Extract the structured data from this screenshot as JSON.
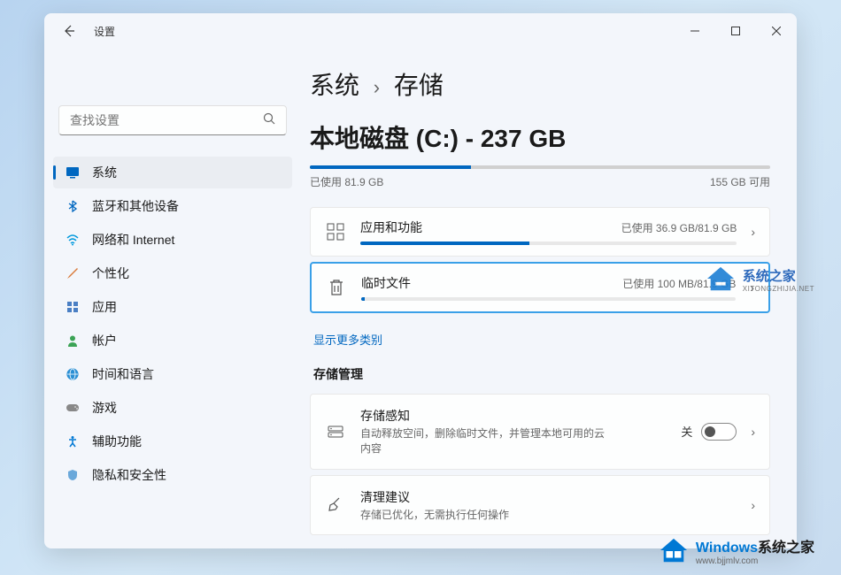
{
  "app_title": "设置",
  "search": {
    "placeholder": "查找设置"
  },
  "nav": [
    {
      "label": "系统",
      "active": true
    },
    {
      "label": "蓝牙和其他设备",
      "active": false
    },
    {
      "label": "网络和 Internet",
      "active": false
    },
    {
      "label": "个性化",
      "active": false
    },
    {
      "label": "应用",
      "active": false
    },
    {
      "label": "帐户",
      "active": false
    },
    {
      "label": "时间和语言",
      "active": false
    },
    {
      "label": "游戏",
      "active": false
    },
    {
      "label": "辅助功能",
      "active": false
    },
    {
      "label": "隐私和安全性",
      "active": false
    }
  ],
  "breadcrumb": {
    "parent": "系统",
    "current": "存储"
  },
  "disk": {
    "title": "本地磁盘 (C:) - 237 GB",
    "used_label": "已使用 81.9 GB",
    "free_label": "155 GB 可用",
    "used_pct": 35
  },
  "cards": [
    {
      "title": "应用和功能",
      "meta": "已使用 36.9 GB/81.9 GB",
      "pct": 45
    },
    {
      "title": "临时文件",
      "meta": "已使用 100 MB/81.9 GB",
      "pct": 1
    }
  ],
  "show_more": "显示更多类别",
  "mgmt_title": "存储管理",
  "mgmt": [
    {
      "title": "存储感知",
      "sub": "自动释放空间，删除临时文件，并管理本地可用的云内容",
      "toggle": "关"
    },
    {
      "title": "清理建议",
      "sub": "存储已优化，无需执行任何操作"
    }
  ],
  "watermark1": {
    "brand": "系统之家",
    "sub": "XITONGZHIJIA.NET"
  },
  "watermark2": {
    "brand_a": "Windows",
    "brand_b": "系统之家",
    "sub": "www.bjjmlv.com"
  }
}
